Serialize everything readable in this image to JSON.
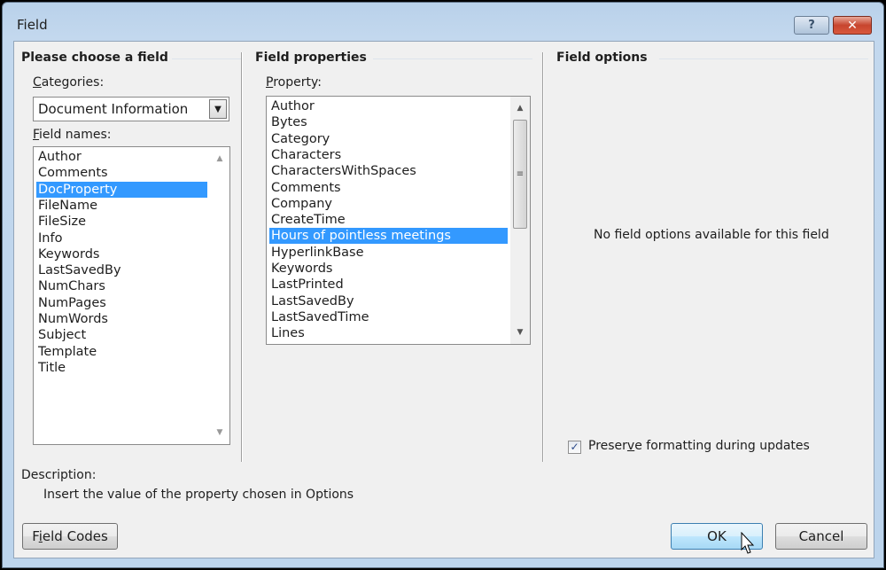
{
  "window": {
    "title": "Field",
    "help_button": "?",
    "close_button": "✕"
  },
  "choose_field": {
    "group_title": "Please choose a field",
    "categories_label": "Categories:",
    "categories_accesskey": "C",
    "categories_rest": "ategories:",
    "categories_value": "Document Information",
    "field_names_label_key": "F",
    "field_names_label_rest": "ield names:",
    "field_names": [
      "Author",
      "Comments",
      "DocProperty",
      "FileName",
      "FileSize",
      "Info",
      "Keywords",
      "LastSavedBy",
      "NumChars",
      "NumPages",
      "NumWords",
      "Subject",
      "Template",
      "Title"
    ],
    "selected_field": "DocProperty"
  },
  "field_properties": {
    "group_title": "Field properties",
    "property_label_key": "P",
    "property_label_rest": "roperty:",
    "properties": [
      "Author",
      "Bytes",
      "Category",
      "Characters",
      "CharactersWithSpaces",
      "Comments",
      "Company",
      "CreateTime",
      "Hours of pointless meetings",
      "HyperlinkBase",
      "Keywords",
      "LastPrinted",
      "LastSavedBy",
      "LastSavedTime",
      "Lines"
    ],
    "selected_property": "Hours of pointless meetings"
  },
  "field_options": {
    "group_title": "Field options",
    "message": "No field options available for this field",
    "preserve_label_a": "Preser",
    "preserve_label_key": "v",
    "preserve_label_b": "e formatting during updates",
    "preserve_checked": true
  },
  "description": {
    "label": "Description:",
    "text": "Insert the value of the property chosen in Options"
  },
  "buttons": {
    "field_codes_a": "F",
    "field_codes_key": "i",
    "field_codes_b": "eld Codes",
    "ok": "OK",
    "cancel": "Cancel"
  }
}
